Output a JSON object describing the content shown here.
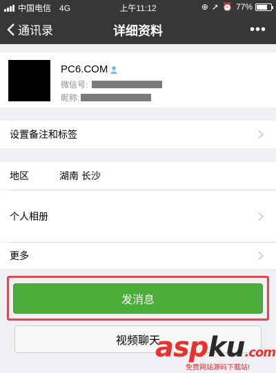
{
  "status_bar": {
    "carrier": "中国电信",
    "network": "4G",
    "time": "上午11:12",
    "battery_percent": "77%",
    "battery_level": 0.77
  },
  "nav": {
    "back_label": "通讯录",
    "title": "详细资料",
    "more_label": "•••"
  },
  "profile": {
    "name": "PC6.COM",
    "wechat_id_label": "微信号:",
    "nickname_label": "昵称:"
  },
  "rows": {
    "remark_tags": "设置备注和标签",
    "region_label": "地区",
    "region_value": "湖南 长沙",
    "album": "个人相册",
    "more": "更多"
  },
  "actions": {
    "send_message": "发消息",
    "video_call": "视频聊天"
  },
  "watermark": {
    "brand_asp": "asp",
    "brand_ku": "ku",
    "brand_dot": ".",
    "brand_com": "com",
    "tagline": "免费网站源码下载站!"
  },
  "colors": {
    "nav_bg": "#373737",
    "primary_button": "#4cae3a",
    "highlight": "#e0484f"
  }
}
